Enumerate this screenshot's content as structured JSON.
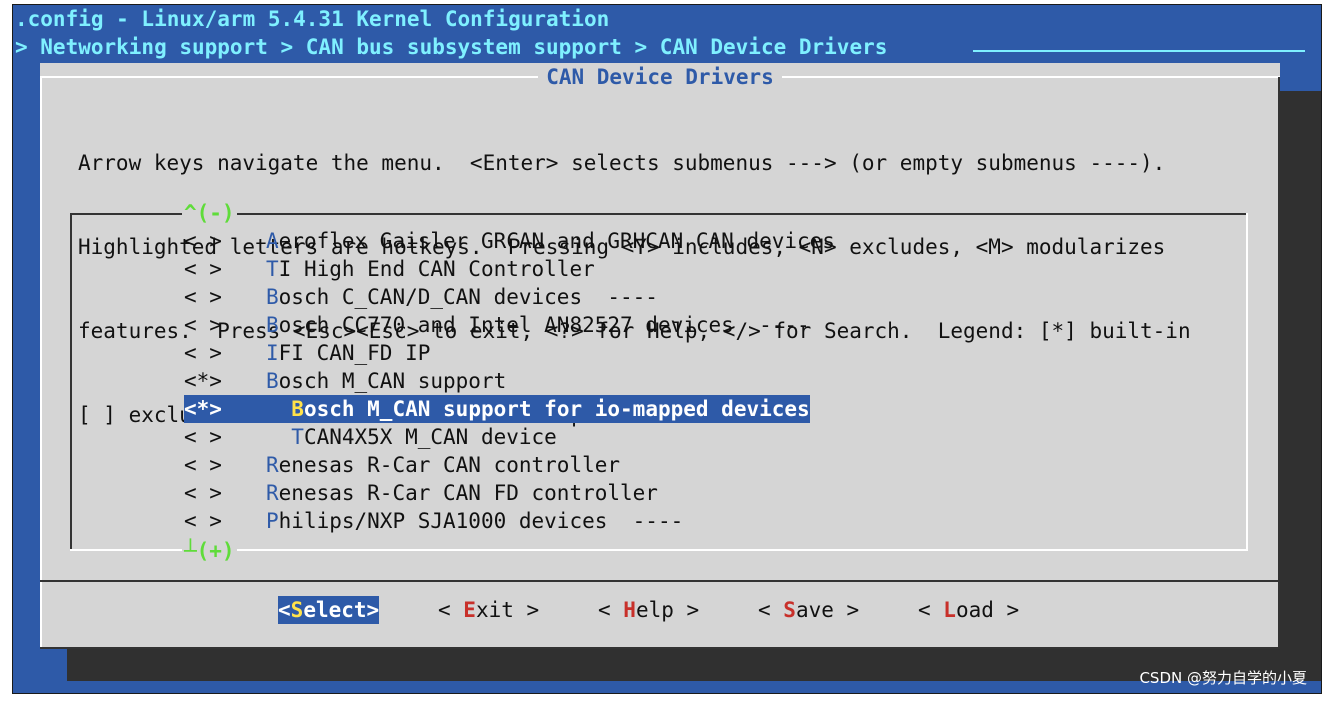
{
  "header": {
    "title": ".config - Linux/arm 5.4.31 Kernel Configuration",
    "breadcrumb": "> Networking support > CAN bus subsystem support > CAN Device Drivers"
  },
  "dialog": {
    "title": "CAN Device Drivers",
    "help_lines": [
      "Arrow keys navigate the menu.  <Enter> selects submenus ---> (or empty submenus ----).",
      "Highlighted letters are hotkeys.  Pressing <Y> includes, <N> excludes, <M> modularizes",
      "features.  Press <Esc><Esc> to exit, <?> for Help, </> for Search.  Legend: [*] built-in",
      "[ ] excluded  <M> module  < > module capable"
    ],
    "scroll_up": "^(-)",
    "scroll_down": "┴(+)"
  },
  "menu": {
    "items": [
      {
        "mark": "< >",
        "hot": "A",
        "rest": "eroflex Gaisler GRCAN and GRHCAN CAN devices",
        "indent": "",
        "selected": false
      },
      {
        "mark": "< >",
        "hot": "T",
        "rest": "I High End CAN Controller",
        "indent": "",
        "selected": false
      },
      {
        "mark": "< >",
        "hot": "B",
        "rest": "osch C_CAN/D_CAN devices  ----",
        "indent": "",
        "selected": false
      },
      {
        "mark": "< >",
        "hot": "B",
        "rest": "osch CC770 and Intel AN82527 devices  ----",
        "indent": "",
        "selected": false
      },
      {
        "mark": "< >",
        "hot": "I",
        "rest": "FI CAN_FD IP",
        "indent": "",
        "selected": false
      },
      {
        "mark": "<*>",
        "hot": "B",
        "rest": "osch M_CAN support",
        "indent": "",
        "selected": false
      },
      {
        "mark": "<*>",
        "hot": "B",
        "rest": "osch M_CAN support for io-mapped devices",
        "indent": "  ",
        "selected": true
      },
      {
        "mark": "< >",
        "hot": "T",
        "rest": "CAN4X5X M_CAN device",
        "indent": "  ",
        "selected": false
      },
      {
        "mark": "< >",
        "hot": "R",
        "rest": "enesas R-Car CAN controller",
        "indent": "",
        "selected": false
      },
      {
        "mark": "< >",
        "hot": "R",
        "rest": "enesas R-Car CAN FD controller",
        "indent": "",
        "selected": false
      },
      {
        "mark": "< >",
        "hot": "P",
        "rest": "hilips/NXP SJA1000 devices  ----",
        "indent": "",
        "selected": false
      }
    ]
  },
  "buttons": [
    {
      "pre": "<",
      "hot": "S",
      "rest": "elect>",
      "active": true
    },
    {
      "pre": "< ",
      "hot": "E",
      "rest": "xit >",
      "active": false
    },
    {
      "pre": "< ",
      "hot": "H",
      "rest": "elp >",
      "active": false
    },
    {
      "pre": "< ",
      "hot": "S",
      "rest": "ave >",
      "active": false
    },
    {
      "pre": "< ",
      "hot": "L",
      "rest": "oad >",
      "active": false
    }
  ],
  "watermark": "CSDN @努力自学的小夏",
  "colors": {
    "screen_bg": "#2e5aa8",
    "dialog_bg": "#d5d5d5",
    "header_text": "#7ff0ff",
    "hotkey": "#2e5aa8",
    "selected_hotkey": "#ffe24a",
    "button_hotkey": "#c8302a"
  }
}
